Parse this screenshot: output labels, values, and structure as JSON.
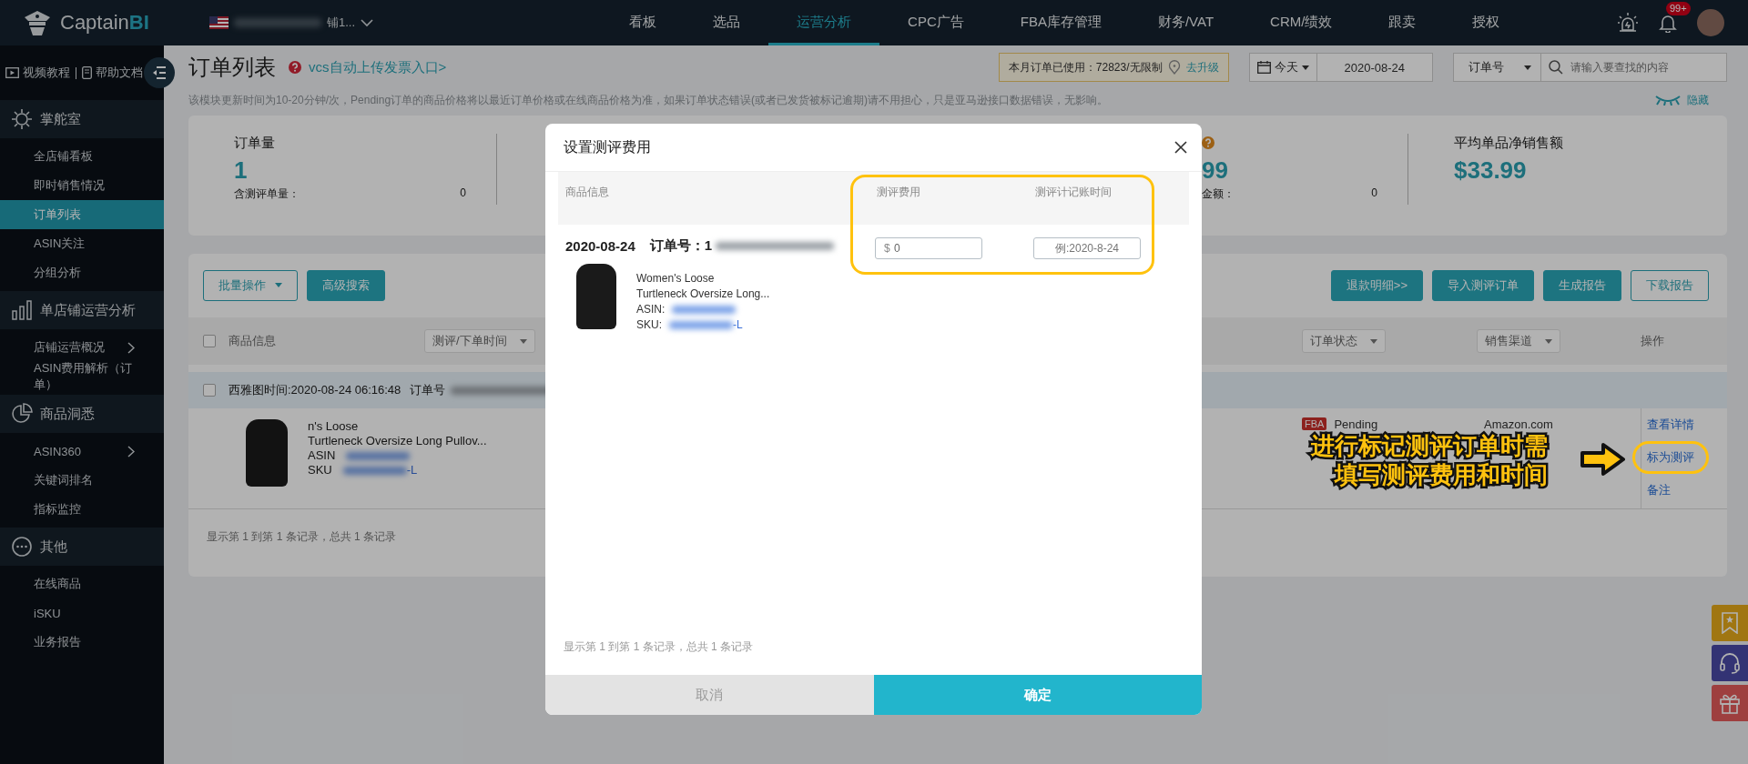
{
  "topbar": {
    "logo": {
      "text": "Captain",
      "accent": "BI"
    },
    "store": "铺1...",
    "nav": [
      {
        "label": "看板",
        "selected": false
      },
      {
        "label": "选品",
        "selected": false
      },
      {
        "label": "运营分析",
        "selected": true
      },
      {
        "label": "CPC广告",
        "selected": false
      },
      {
        "label": "FBA库存管理",
        "selected": false
      },
      {
        "label": "财务/VAT",
        "selected": false
      },
      {
        "label": "CRM/绩效",
        "selected": false
      },
      {
        "label": "跟卖",
        "selected": false
      },
      {
        "label": "授权",
        "selected": false
      }
    ],
    "badge": "99+"
  },
  "sidebar": {
    "links": [
      "视频教程",
      "帮助文档"
    ],
    "sections": [
      {
        "title": "掌舵室",
        "items": [
          {
            "label": "全店铺看板",
            "selected": false,
            "has_submenu": false
          },
          {
            "label": "即时销售情况",
            "selected": false,
            "has_submenu": false
          },
          {
            "label": "订单列表",
            "selected": true,
            "has_submenu": false
          },
          {
            "label": "ASIN关注",
            "selected": false,
            "has_submenu": false
          },
          {
            "label": "分组分析",
            "selected": false,
            "has_submenu": false
          }
        ]
      },
      {
        "title": "单店铺运营分析",
        "items": [
          {
            "label": "店铺运营概况",
            "selected": false,
            "has_submenu": true
          },
          {
            "label": "ASIN费用解析（订单）",
            "selected": false,
            "has_submenu": false
          }
        ]
      },
      {
        "title": "商品洞悉",
        "items": [
          {
            "label": "ASIN360",
            "selected": false,
            "has_submenu": true
          },
          {
            "label": "关键词排名",
            "selected": false,
            "has_submenu": false
          },
          {
            "label": "指标监控",
            "selected": false,
            "has_submenu": false
          }
        ]
      },
      {
        "title": "其他",
        "items": [
          {
            "label": "在线商品",
            "selected": false,
            "has_submenu": false
          },
          {
            "label": "iSKU",
            "selected": false,
            "has_submenu": false
          },
          {
            "label": "业务报告",
            "selected": false,
            "has_submenu": false
          }
        ]
      }
    ]
  },
  "header": {
    "title": "订单列表",
    "vcs_link": "vcs自动上传发票入口>",
    "usage": {
      "text": "本月订单已使用：72823/无限制",
      "upgrade": "去升级"
    },
    "date_filter": {
      "range": "今天",
      "date": "2020-08-24"
    },
    "search": {
      "field": "订单号",
      "placeholder": "请输入要查找的内容"
    },
    "notice": "该模块更新时间为10-20分钟/次，Pending订单的商品价格将以最近订单价格或在线商品价格为准，如果订单状态错误(或者已发货被标记逾期)请不用担心，只是亚马逊接口数据错误，无影响。",
    "hide_link": "隐藏"
  },
  "stats": [
    {
      "label": "订单量",
      "value": "1",
      "sub_label": "含测评单量：",
      "sub_value": "0"
    },
    {
      "value": "99",
      "sub_label": "金额：",
      "sub_value": "0",
      "help": true
    },
    {
      "label": "平均单品净销售额",
      "value": "$33.99"
    }
  ],
  "toolbar": {
    "left": [
      {
        "label": "批量操作",
        "kind": "dropdown"
      },
      {
        "label": "高级搜索",
        "kind": "filled"
      }
    ],
    "right": [
      {
        "label": "退款明细>>",
        "kind": "filled"
      },
      {
        "label": "导入测评订单",
        "kind": "filled"
      },
      {
        "label": "生成报告",
        "kind": "filled"
      },
      {
        "label": "下载报告",
        "kind": "outline"
      }
    ]
  },
  "table": {
    "header_checked": false,
    "columns": [
      {
        "label": "商品信息",
        "kind": "text"
      },
      {
        "label": "测评/下单时间",
        "kind": "select"
      },
      {
        "label": "订单状态",
        "kind": "select"
      },
      {
        "label": "销售渠道",
        "kind": "select"
      },
      {
        "label": "操作",
        "kind": "text"
      }
    ],
    "group": {
      "checked": false,
      "time": "西雅图时间:2020-08-24 06:16:48",
      "order_label": "订单号"
    },
    "row": {
      "title_lines": [
        "n's Loose",
        "Turtleneck Oversize Long Pullov..."
      ],
      "asin_label": "ASIN",
      "sku_label": "SKU",
      "sku_value": "-L",
      "badge": "FBA",
      "status": "Pending",
      "channel": "Amazon.com",
      "actions": [
        "查看详情",
        "标为测评",
        "备注"
      ]
    },
    "footer": "显示第 1 到第 1 条记录，总共 1 条记录"
  },
  "modal": {
    "title": "设置测评费用",
    "columns": [
      "商品信息",
      "测评费用",
      "测评计记账时间"
    ],
    "row": {
      "date": "2020-08-24",
      "order_label": "订单号：1",
      "title_lines": [
        "Women's Loose",
        "Turtleneck Oversize Long..."
      ],
      "asin_label": "ASIN:",
      "sku_label": "SKU:",
      "sku_value": "-L",
      "fee_prefix": "$",
      "fee_value": "0",
      "date_placeholder": "例:2020-8-24"
    },
    "footer": "显示第 1 到第 1 条记录，总共 1 条记录",
    "buttons": [
      {
        "label": "取消",
        "kind": "cancel"
      },
      {
        "label": "确定",
        "kind": "confirm"
      }
    ]
  },
  "annotation": {
    "lines": [
      "进行标记测评订单时需",
      "填写测评费用和时间"
    ]
  }
}
